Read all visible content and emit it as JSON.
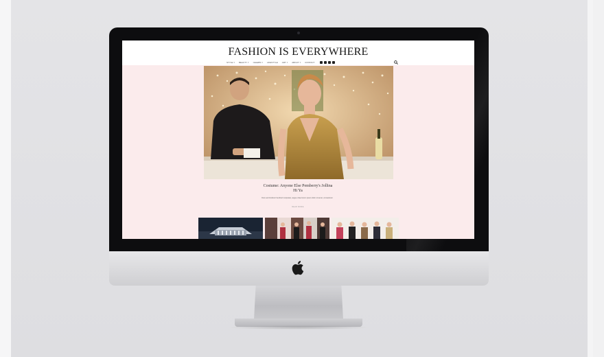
{
  "site": {
    "title": "FASHION IS EVERYWHERE",
    "nav": [
      {
        "label": "STYLE",
        "has_caret": true
      },
      {
        "label": "BEAUTY",
        "has_caret": true
      },
      {
        "label": "CELEBS",
        "has_caret": true
      },
      {
        "label": "LIFESTYLE",
        "has_caret": false
      },
      {
        "label": "ART",
        "has_caret": true
      },
      {
        "label": "ABOUT",
        "has_caret": true
      },
      {
        "label": "CONTACT",
        "has_caret": false
      }
    ],
    "social_icons": [
      "facebook-icon",
      "instagram-icon",
      "pinterest-icon",
      "twitter-icon"
    ],
    "search_icon": "search-icon",
    "featured": {
      "title": "Costume: Anyone Else Pemberry's Jollina",
      "title_line2": "Hi Ya",
      "subtitle": "Duis sed tincidunt hendrerit vulputate, augue vitae lorem ipsum dolor sit amet, consectetur",
      "read_more": "READ MORE"
    }
  },
  "colors": {
    "screen_bg": "#fbebec",
    "header_bg": "#ffffff",
    "bezel": "#0d0d0f",
    "stand": "#cfcfd2"
  },
  "device": {
    "logo": "apple-logo"
  }
}
